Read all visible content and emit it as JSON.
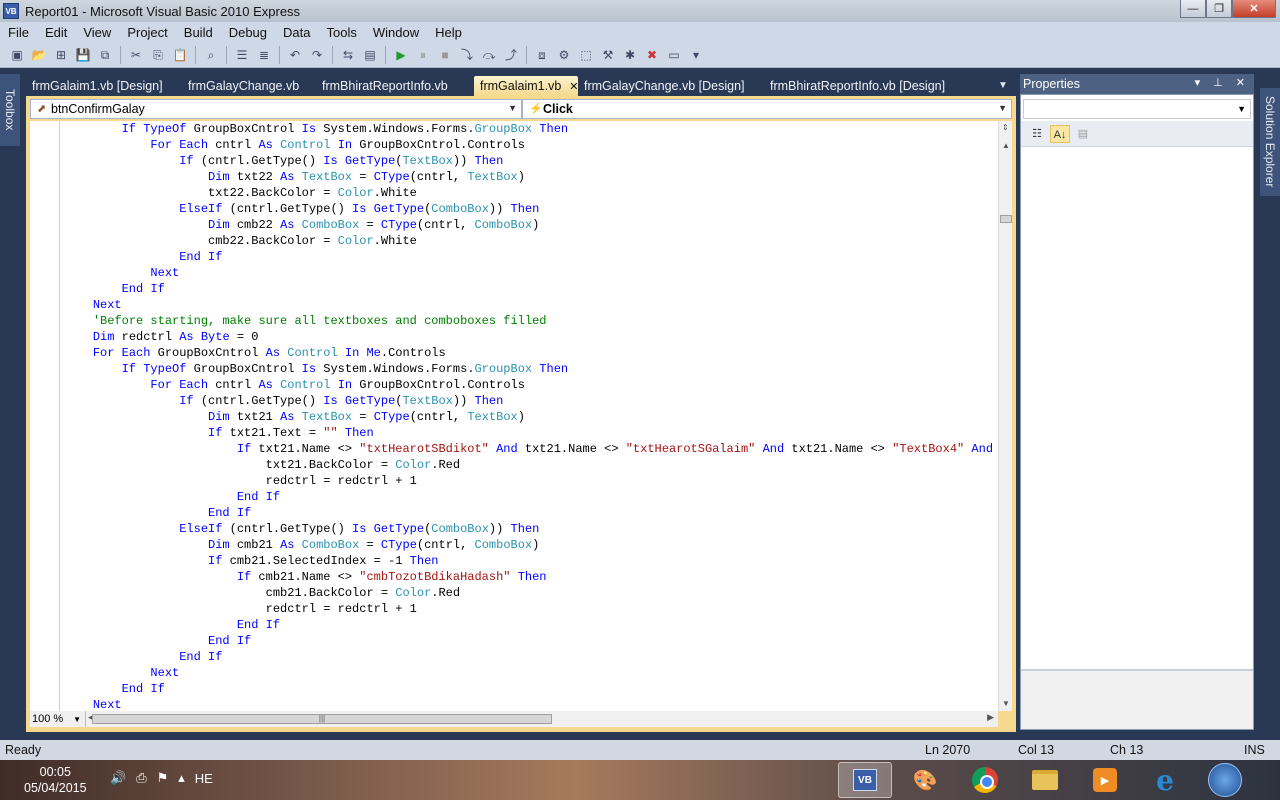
{
  "window": {
    "title": "Report01 - Microsoft Visual Basic 2010 Express",
    "app_icon_text": "VB",
    "min": "—",
    "max": "❐",
    "close": "✕"
  },
  "menu": [
    "File",
    "Edit",
    "View",
    "Project",
    "Build",
    "Debug",
    "Data",
    "Tools",
    "Window",
    "Help"
  ],
  "toolbar_icons": [
    "new-project-icon",
    "open-icon",
    "add-item-icon",
    "save-icon",
    "save-all-icon",
    "cut-icon",
    "copy-icon",
    "paste-icon",
    "find-icon",
    "comment-icon",
    "uncomment-icon",
    "undo-icon",
    "redo-icon",
    "navigate-icon",
    "start-icon",
    "pause-icon",
    "stop-icon",
    "step-into-icon",
    "step-over-icon",
    "step-out-icon",
    "solution-explorer-icon",
    "properties-icon",
    "object-browser-icon",
    "toolbox-icon",
    "error-list-icon",
    "output-icon"
  ],
  "side_tabs": {
    "toolbox": "Toolbox",
    "solution_explorer": "Solution Explorer"
  },
  "doc_tabs": [
    {
      "label": "frmGalaim1.vb [Design]",
      "active": false
    },
    {
      "label": "frmGalayChange.vb",
      "active": false
    },
    {
      "label": "frmBhiratReportInfo.vb",
      "active": false
    },
    {
      "label": "frmGalaim1.vb",
      "active": true
    },
    {
      "label": "frmGalayChange.vb [Design]",
      "active": false
    },
    {
      "label": "frmBhiratReportInfo.vb [Design]",
      "active": false
    }
  ],
  "tab_close": "✕",
  "tab_overflow": "▼",
  "navbar": {
    "object": "btnConfirmGalay",
    "event": "Click"
  },
  "zoom": "100 %",
  "properties": {
    "title": "Properties",
    "header_buttons": "▾ ⊥ ✕"
  },
  "status": {
    "ready": "Ready",
    "ln": "Ln 2070",
    "col": "Col 13",
    "ch": "Ch 13",
    "mode": "INS"
  },
  "taskbar": {
    "time": "00:05",
    "date": "05/04/2015",
    "lang": "HE"
  },
  "colors": {
    "keyword": "#0000ff",
    "type": "#2b91af",
    "string": "#a31515",
    "comment": "#008000"
  },
  "code_lines": [
    [
      [
        "",
        "        "
      ],
      [
        "kw",
        "If TypeOf"
      ],
      [
        "",
        " GroupBoxCntrol "
      ],
      [
        "kw",
        "Is"
      ],
      [
        "",
        " System.Windows.Forms."
      ],
      [
        "ty",
        "GroupBox"
      ],
      [
        "",
        " "
      ],
      [
        "kw",
        "Then"
      ]
    ],
    [
      [
        "",
        "            "
      ],
      [
        "kw",
        "For Each"
      ],
      [
        "",
        " cntrl "
      ],
      [
        "kw",
        "As"
      ],
      [
        "",
        " "
      ],
      [
        "ty",
        "Control"
      ],
      [
        "",
        " "
      ],
      [
        "kw",
        "In"
      ],
      [
        "",
        " GroupBoxCntrol.Controls"
      ]
    ],
    [
      [
        "",
        "                "
      ],
      [
        "kw",
        "If"
      ],
      [
        "",
        " (cntrl.GetType() "
      ],
      [
        "kw",
        "Is"
      ],
      [
        "",
        " "
      ],
      [
        "kw",
        "GetType"
      ],
      [
        "",
        "("
      ],
      [
        "ty",
        "TextBox"
      ],
      [
        "",
        "))"
      ],
      [
        "",
        " "
      ],
      [
        "kw",
        "Then"
      ]
    ],
    [
      [
        "",
        "                    "
      ],
      [
        "kw",
        "Dim"
      ],
      [
        "",
        " txt22 "
      ],
      [
        "kw",
        "As"
      ],
      [
        "",
        " "
      ],
      [
        "ty",
        "TextBox"
      ],
      [
        "",
        " = "
      ],
      [
        "kw",
        "CType"
      ],
      [
        "",
        "(cntrl, "
      ],
      [
        "ty",
        "TextBox"
      ],
      [
        "",
        ")"
      ]
    ],
    [
      [
        "",
        "                    txt22.BackColor = "
      ],
      [
        "ty",
        "Color"
      ],
      [
        "",
        ".White"
      ]
    ],
    [
      [
        "",
        "                "
      ],
      [
        "kw",
        "ElseIf"
      ],
      [
        "",
        " (cntrl.GetType() "
      ],
      [
        "kw",
        "Is"
      ],
      [
        "",
        " "
      ],
      [
        "kw",
        "GetType"
      ],
      [
        "",
        "("
      ],
      [
        "ty",
        "ComboBox"
      ],
      [
        "",
        "))"
      ],
      [
        "",
        " "
      ],
      [
        "kw",
        "Then"
      ]
    ],
    [
      [
        "",
        "                    "
      ],
      [
        "kw",
        "Dim"
      ],
      [
        "",
        " cmb22 "
      ],
      [
        "kw",
        "As"
      ],
      [
        "",
        " "
      ],
      [
        "ty",
        "ComboBox"
      ],
      [
        "",
        " = "
      ],
      [
        "kw",
        "CType"
      ],
      [
        "",
        "(cntrl, "
      ],
      [
        "ty",
        "ComboBox"
      ],
      [
        "",
        ")"
      ]
    ],
    [
      [
        "",
        "                    cmb22.BackColor = "
      ],
      [
        "ty",
        "Color"
      ],
      [
        "",
        ".White"
      ]
    ],
    [
      [
        "",
        "                "
      ],
      [
        "kw",
        "End If"
      ]
    ],
    [
      [
        "",
        "            "
      ],
      [
        "kw",
        "Next"
      ]
    ],
    [
      [
        "",
        "        "
      ],
      [
        "kw",
        "End If"
      ]
    ],
    [
      [
        "",
        "    "
      ],
      [
        "kw",
        "Next"
      ]
    ],
    [
      [
        "",
        "    "
      ],
      [
        "cm",
        "'Before starting, make sure all textboxes and comboboxes filled"
      ]
    ],
    [
      [
        "",
        "    "
      ],
      [
        "kw",
        "Dim"
      ],
      [
        "",
        " redctrl "
      ],
      [
        "kw",
        "As"
      ],
      [
        "",
        " "
      ],
      [
        "kw",
        "Byte"
      ],
      [
        "",
        " = 0"
      ]
    ],
    [
      [
        "",
        "    "
      ],
      [
        "kw",
        "For Each"
      ],
      [
        "",
        " GroupBoxCntrol "
      ],
      [
        "kw",
        "As"
      ],
      [
        "",
        " "
      ],
      [
        "ty",
        "Control"
      ],
      [
        "",
        " "
      ],
      [
        "kw",
        "In"
      ],
      [
        "",
        " "
      ],
      [
        "kw",
        "Me"
      ],
      [
        "",
        ".Controls"
      ]
    ],
    [
      [
        "",
        "        "
      ],
      [
        "kw",
        "If TypeOf"
      ],
      [
        "",
        " GroupBoxCntrol "
      ],
      [
        "kw",
        "Is"
      ],
      [
        "",
        " System.Windows.Forms."
      ],
      [
        "ty",
        "GroupBox"
      ],
      [
        "",
        " "
      ],
      [
        "kw",
        "Then"
      ]
    ],
    [
      [
        "",
        "            "
      ],
      [
        "kw",
        "For Each"
      ],
      [
        "",
        " cntrl "
      ],
      [
        "kw",
        "As"
      ],
      [
        "",
        " "
      ],
      [
        "ty",
        "Control"
      ],
      [
        "",
        " "
      ],
      [
        "kw",
        "In"
      ],
      [
        "",
        " GroupBoxCntrol.Controls"
      ]
    ],
    [
      [
        "",
        "                "
      ],
      [
        "kw",
        "If"
      ],
      [
        "",
        " (cntrl.GetType() "
      ],
      [
        "kw",
        "Is"
      ],
      [
        "",
        " "
      ],
      [
        "kw",
        "GetType"
      ],
      [
        "",
        "("
      ],
      [
        "ty",
        "TextBox"
      ],
      [
        "",
        "))"
      ],
      [
        "",
        " "
      ],
      [
        "kw",
        "Then"
      ]
    ],
    [
      [
        "",
        "                    "
      ],
      [
        "kw",
        "Dim"
      ],
      [
        "",
        " txt21 "
      ],
      [
        "kw",
        "As"
      ],
      [
        "",
        " "
      ],
      [
        "ty",
        "TextBox"
      ],
      [
        "",
        " = "
      ],
      [
        "kw",
        "CType"
      ],
      [
        "",
        "(cntrl, "
      ],
      [
        "ty",
        "TextBox"
      ],
      [
        "",
        ")"
      ]
    ],
    [
      [
        "",
        "                    "
      ],
      [
        "kw",
        "If"
      ],
      [
        "",
        " txt21.Text = "
      ],
      [
        "str",
        "\"\""
      ],
      [
        "",
        " "
      ],
      [
        "kw",
        "Then"
      ]
    ],
    [
      [
        "",
        "                        "
      ],
      [
        "kw",
        "If"
      ],
      [
        "",
        " txt21.Name <> "
      ],
      [
        "str",
        "\"txtHearotSBdikot\""
      ],
      [
        "",
        " "
      ],
      [
        "kw",
        "And"
      ],
      [
        "",
        " txt21.Name <> "
      ],
      [
        "str",
        "\"txtHearotSGalaim\""
      ],
      [
        "",
        " "
      ],
      [
        "kw",
        "And"
      ],
      [
        "",
        " txt21.Name <> "
      ],
      [
        "str",
        "\"TextBox4\""
      ],
      [
        "",
        " "
      ],
      [
        "kw",
        "And"
      ]
    ],
    [
      [
        "",
        "                            txt21.BackColor = "
      ],
      [
        "ty",
        "Color"
      ],
      [
        "",
        ".Red"
      ]
    ],
    [
      [
        "",
        "                            redctrl = redctrl + 1"
      ]
    ],
    [
      [
        "",
        "                        "
      ],
      [
        "kw",
        "End If"
      ]
    ],
    [
      [
        "",
        "                    "
      ],
      [
        "kw",
        "End If"
      ]
    ],
    [
      [
        "",
        "                "
      ],
      [
        "kw",
        "ElseIf"
      ],
      [
        "",
        " (cntrl.GetType() "
      ],
      [
        "kw",
        "Is"
      ],
      [
        "",
        " "
      ],
      [
        "kw",
        "GetType"
      ],
      [
        "",
        "("
      ],
      [
        "ty",
        "ComboBox"
      ],
      [
        "",
        "))"
      ],
      [
        "",
        " "
      ],
      [
        "kw",
        "Then"
      ]
    ],
    [
      [
        "",
        "                    "
      ],
      [
        "kw",
        "Dim"
      ],
      [
        "",
        " cmb21 "
      ],
      [
        "kw",
        "As"
      ],
      [
        "",
        " "
      ],
      [
        "ty",
        "ComboBox"
      ],
      [
        "",
        " = "
      ],
      [
        "kw",
        "CType"
      ],
      [
        "",
        "(cntrl, "
      ],
      [
        "ty",
        "ComboBox"
      ],
      [
        "",
        ")"
      ]
    ],
    [
      [
        "",
        "                    "
      ],
      [
        "kw",
        "If"
      ],
      [
        "",
        " cmb21.SelectedIndex = -1 "
      ],
      [
        "kw",
        "Then"
      ]
    ],
    [
      [
        "",
        "                        "
      ],
      [
        "kw",
        "If"
      ],
      [
        "",
        " cmb21.Name <> "
      ],
      [
        "str",
        "\"cmbTozotBdikaHadash\""
      ],
      [
        "",
        " "
      ],
      [
        "kw",
        "Then"
      ]
    ],
    [
      [
        "",
        "                            cmb21.BackColor = "
      ],
      [
        "ty",
        "Color"
      ],
      [
        "",
        ".Red"
      ]
    ],
    [
      [
        "",
        "                            redctrl = redctrl + 1"
      ]
    ],
    [
      [
        "",
        "                        "
      ],
      [
        "kw",
        "End If"
      ]
    ],
    [
      [
        "",
        "                    "
      ],
      [
        "kw",
        "End If"
      ]
    ],
    [
      [
        "",
        "                "
      ],
      [
        "kw",
        "End If"
      ]
    ],
    [
      [
        "",
        "            "
      ],
      [
        "kw",
        "Next"
      ]
    ],
    [
      [
        "",
        "        "
      ],
      [
        "kw",
        "End If"
      ]
    ],
    [
      [
        "",
        "    "
      ],
      [
        "kw",
        "Next"
      ]
    ]
  ]
}
